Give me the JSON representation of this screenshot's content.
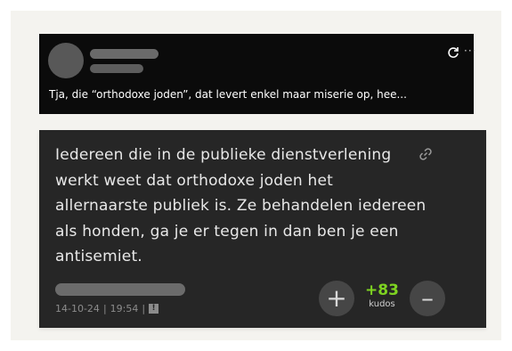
{
  "quoted_post": {
    "text": "Tja, die “orthodoxe joden”, dat levert enkel maar miserie op, hee...",
    "more_label": "···"
  },
  "comment": {
    "body": "Iedereen die in de publieke dienstverlening werkt weet dat orthodoxe joden het allernaarste publiek is. Ze behandelen iedereen als honden, ga je er tegen in dan ben je een antisemiet.",
    "date": "14-10-24",
    "separator": "|",
    "time": "19:54",
    "report_label": "!"
  },
  "votes": {
    "up_label": "+",
    "count": "+83",
    "unit": "kudos",
    "down_label": "–"
  },
  "icons": {
    "refresh": "refresh-icon",
    "link": "link-icon"
  },
  "colors": {
    "kudos": "#7ed321",
    "card_bg": "#262626",
    "quote_bg": "#0b0b0b"
  }
}
